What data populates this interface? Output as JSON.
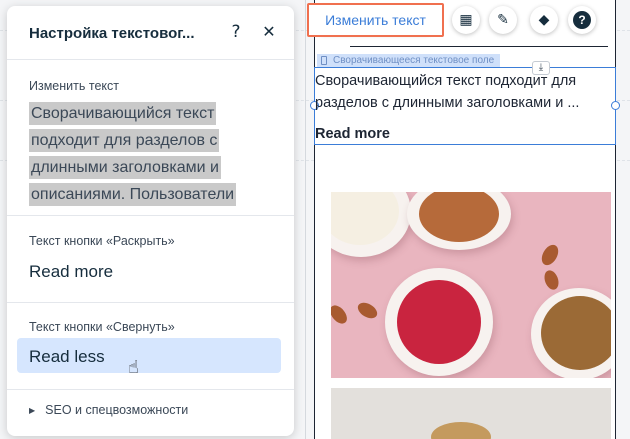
{
  "panel": {
    "title": "Настройка текстовог...",
    "help_label": "?",
    "close_label": "✕",
    "edit_text": {
      "label": "Изменить текст",
      "value": "Сворачивающийся текст подходит для разделов с длинными заголовками и описаниями. Пользователи"
    },
    "expand_button": {
      "label": "Текст кнопки «Раскрыть»",
      "value": "Read more"
    },
    "collapse_button": {
      "label": "Текст кнопки «Свернуть»",
      "value": "Read less"
    },
    "seo": {
      "label": "SEO и спецвозможности"
    }
  },
  "toolbar": {
    "edit_text_label": "Изменить текст",
    "help_label": "?"
  },
  "canvas": {
    "element_tag": "Сворачивающееся текстовое поле",
    "body_line1": "Сворачивающийся текст подходит для",
    "body_line2": "разделов с длинными заголовками и ...",
    "read_more": "Read more"
  },
  "colors": {
    "accent": "#3b7dd8",
    "highlight_border": "#f0704f",
    "input_highlight": "#d6e6fe",
    "photo_bg": "#e9b5bf"
  },
  "icons": [
    "question-icon",
    "close-icon",
    "layout-icon",
    "brush-icon",
    "animation-icon",
    "help-icon",
    "anchor-icon",
    "pointer-hand-icon",
    "expand-triangle-icon"
  ]
}
